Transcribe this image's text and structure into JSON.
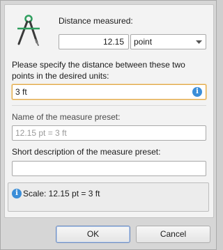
{
  "dialog": {
    "distance_label": "Distance measured:",
    "distance_value": "12.15",
    "unit_value": "point",
    "prompt_label": "Please specify the distance between these two points in the desired units:",
    "units_input_value": "3 ft",
    "preset_name_label": "Name of the measure preset:",
    "preset_name_placeholder": "12.15 pt = 3 ft",
    "description_label": "Short description of the measure preset:",
    "description_value": "",
    "scale_text": "Scale: 12.15 pt = 3 ft"
  },
  "buttons": {
    "ok_label": "OK",
    "cancel_label": "Cancel"
  },
  "icons": {
    "header": "compass-icon",
    "info": "info-icon",
    "dropdown": "chevron-down-icon"
  },
  "colors": {
    "accent_focus": "#e1a94a",
    "info_blue": "#3b8ed8",
    "compass_green": "#2f9e5e"
  }
}
